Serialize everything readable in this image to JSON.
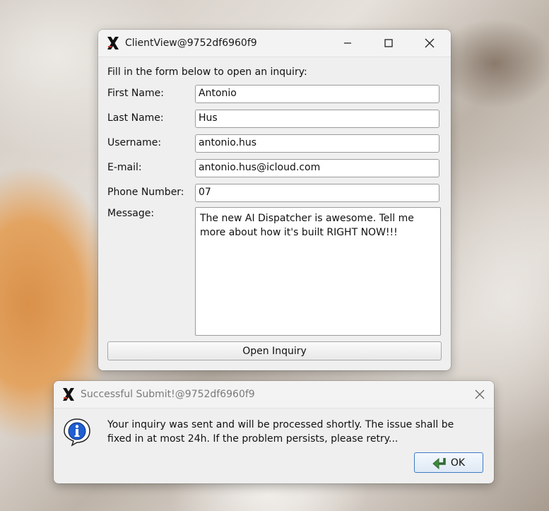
{
  "main_window": {
    "title": "ClientView@9752df6960f9",
    "instruction": "Fill in the form below to open an inquiry:",
    "fields": {
      "first_name": {
        "label": "First Name:",
        "value": "Antonio"
      },
      "last_name": {
        "label": "Last Name:",
        "value": "Hus"
      },
      "username": {
        "label": "Username:",
        "value": "antonio.hus"
      },
      "email": {
        "label": "E-mail:",
        "value": "antonio.hus@icloud.com"
      },
      "phone": {
        "label": "Phone Number:",
        "value": "07"
      },
      "message": {
        "label": "Message:",
        "value": "The new AI Dispatcher is awesome. Tell me\nmore about how it's built RIGHT NOW!!!"
      }
    },
    "submit_label": "Open Inquiry"
  },
  "dialog": {
    "title": "Successful Submit!@9752df6960f9",
    "message_line1": "Your inquiry was sent and will be processed shortly. The issue shall be",
    "message_line2": "fixed in at most 24h. If the problem persists, please retry...",
    "ok_label": "OK"
  },
  "icons": {
    "app": "x11-logo-icon",
    "minimize": "minimize-icon",
    "maximize": "maximize-icon",
    "close": "close-icon",
    "info": "info-icon",
    "ok": "return-arrow-icon"
  },
  "colors": {
    "window_bg": "#efefef",
    "titlebar_bg": "#f3f3f3",
    "ok_border": "#3e7bc4"
  }
}
